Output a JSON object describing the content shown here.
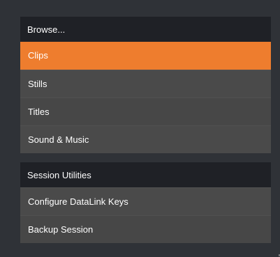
{
  "browse": {
    "header": "Browse...",
    "items": [
      {
        "label": "Clips",
        "selected": true
      },
      {
        "label": "Stills",
        "selected": false
      },
      {
        "label": "Titles",
        "selected": false
      },
      {
        "label": "Sound & Music",
        "selected": false
      }
    ]
  },
  "session": {
    "header": "Session Utilities",
    "items": [
      {
        "label": "Configure DataLink Keys"
      },
      {
        "label": "Backup Session"
      }
    ]
  },
  "colors": {
    "accent": "#ee7d2e",
    "panel": "#4a4a4a",
    "header": "#1f2126",
    "background": "#2f3237"
  }
}
